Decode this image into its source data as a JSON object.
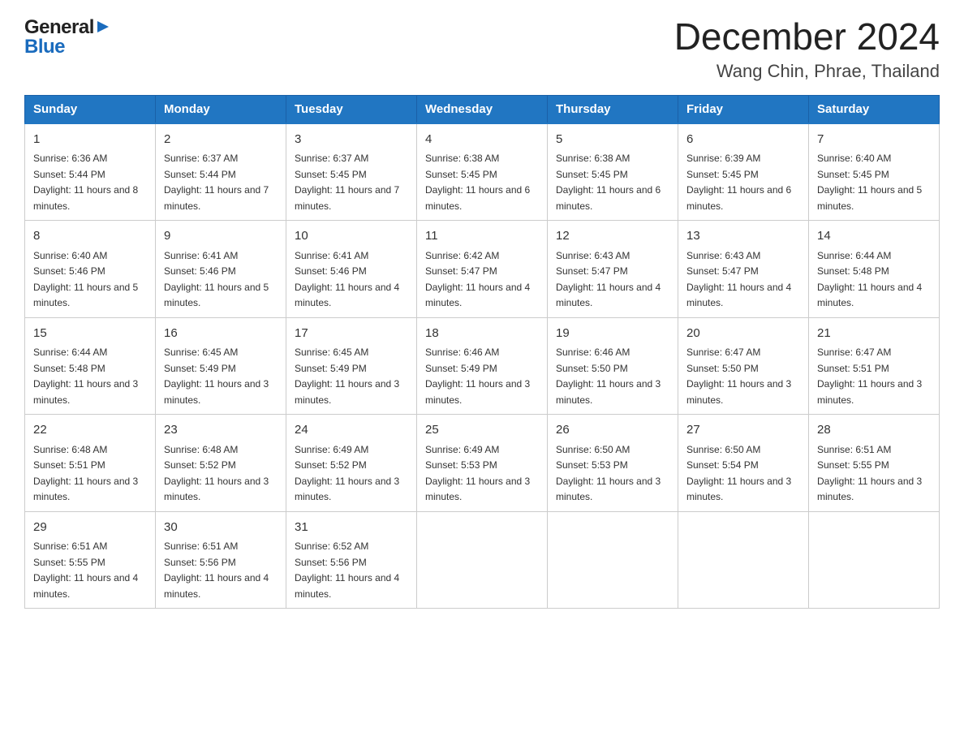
{
  "header": {
    "logo_general": "General",
    "logo_blue": "Blue",
    "month_title": "December 2024",
    "location": "Wang Chin, Phrae, Thailand"
  },
  "days_of_week": [
    "Sunday",
    "Monday",
    "Tuesday",
    "Wednesday",
    "Thursday",
    "Friday",
    "Saturday"
  ],
  "weeks": [
    [
      {
        "day": "1",
        "sunrise": "Sunrise: 6:36 AM",
        "sunset": "Sunset: 5:44 PM",
        "daylight": "Daylight: 11 hours and 8 minutes."
      },
      {
        "day": "2",
        "sunrise": "Sunrise: 6:37 AM",
        "sunset": "Sunset: 5:44 PM",
        "daylight": "Daylight: 11 hours and 7 minutes."
      },
      {
        "day": "3",
        "sunrise": "Sunrise: 6:37 AM",
        "sunset": "Sunset: 5:45 PM",
        "daylight": "Daylight: 11 hours and 7 minutes."
      },
      {
        "day": "4",
        "sunrise": "Sunrise: 6:38 AM",
        "sunset": "Sunset: 5:45 PM",
        "daylight": "Daylight: 11 hours and 6 minutes."
      },
      {
        "day": "5",
        "sunrise": "Sunrise: 6:38 AM",
        "sunset": "Sunset: 5:45 PM",
        "daylight": "Daylight: 11 hours and 6 minutes."
      },
      {
        "day": "6",
        "sunrise": "Sunrise: 6:39 AM",
        "sunset": "Sunset: 5:45 PM",
        "daylight": "Daylight: 11 hours and 6 minutes."
      },
      {
        "day": "7",
        "sunrise": "Sunrise: 6:40 AM",
        "sunset": "Sunset: 5:45 PM",
        "daylight": "Daylight: 11 hours and 5 minutes."
      }
    ],
    [
      {
        "day": "8",
        "sunrise": "Sunrise: 6:40 AM",
        "sunset": "Sunset: 5:46 PM",
        "daylight": "Daylight: 11 hours and 5 minutes."
      },
      {
        "day": "9",
        "sunrise": "Sunrise: 6:41 AM",
        "sunset": "Sunset: 5:46 PM",
        "daylight": "Daylight: 11 hours and 5 minutes."
      },
      {
        "day": "10",
        "sunrise": "Sunrise: 6:41 AM",
        "sunset": "Sunset: 5:46 PM",
        "daylight": "Daylight: 11 hours and 4 minutes."
      },
      {
        "day": "11",
        "sunrise": "Sunrise: 6:42 AM",
        "sunset": "Sunset: 5:47 PM",
        "daylight": "Daylight: 11 hours and 4 minutes."
      },
      {
        "day": "12",
        "sunrise": "Sunrise: 6:43 AM",
        "sunset": "Sunset: 5:47 PM",
        "daylight": "Daylight: 11 hours and 4 minutes."
      },
      {
        "day": "13",
        "sunrise": "Sunrise: 6:43 AM",
        "sunset": "Sunset: 5:47 PM",
        "daylight": "Daylight: 11 hours and 4 minutes."
      },
      {
        "day": "14",
        "sunrise": "Sunrise: 6:44 AM",
        "sunset": "Sunset: 5:48 PM",
        "daylight": "Daylight: 11 hours and 4 minutes."
      }
    ],
    [
      {
        "day": "15",
        "sunrise": "Sunrise: 6:44 AM",
        "sunset": "Sunset: 5:48 PM",
        "daylight": "Daylight: 11 hours and 3 minutes."
      },
      {
        "day": "16",
        "sunrise": "Sunrise: 6:45 AM",
        "sunset": "Sunset: 5:49 PM",
        "daylight": "Daylight: 11 hours and 3 minutes."
      },
      {
        "day": "17",
        "sunrise": "Sunrise: 6:45 AM",
        "sunset": "Sunset: 5:49 PM",
        "daylight": "Daylight: 11 hours and 3 minutes."
      },
      {
        "day": "18",
        "sunrise": "Sunrise: 6:46 AM",
        "sunset": "Sunset: 5:49 PM",
        "daylight": "Daylight: 11 hours and 3 minutes."
      },
      {
        "day": "19",
        "sunrise": "Sunrise: 6:46 AM",
        "sunset": "Sunset: 5:50 PM",
        "daylight": "Daylight: 11 hours and 3 minutes."
      },
      {
        "day": "20",
        "sunrise": "Sunrise: 6:47 AM",
        "sunset": "Sunset: 5:50 PM",
        "daylight": "Daylight: 11 hours and 3 minutes."
      },
      {
        "day": "21",
        "sunrise": "Sunrise: 6:47 AM",
        "sunset": "Sunset: 5:51 PM",
        "daylight": "Daylight: 11 hours and 3 minutes."
      }
    ],
    [
      {
        "day": "22",
        "sunrise": "Sunrise: 6:48 AM",
        "sunset": "Sunset: 5:51 PM",
        "daylight": "Daylight: 11 hours and 3 minutes."
      },
      {
        "day": "23",
        "sunrise": "Sunrise: 6:48 AM",
        "sunset": "Sunset: 5:52 PM",
        "daylight": "Daylight: 11 hours and 3 minutes."
      },
      {
        "day": "24",
        "sunrise": "Sunrise: 6:49 AM",
        "sunset": "Sunset: 5:52 PM",
        "daylight": "Daylight: 11 hours and 3 minutes."
      },
      {
        "day": "25",
        "sunrise": "Sunrise: 6:49 AM",
        "sunset": "Sunset: 5:53 PM",
        "daylight": "Daylight: 11 hours and 3 minutes."
      },
      {
        "day": "26",
        "sunrise": "Sunrise: 6:50 AM",
        "sunset": "Sunset: 5:53 PM",
        "daylight": "Daylight: 11 hours and 3 minutes."
      },
      {
        "day": "27",
        "sunrise": "Sunrise: 6:50 AM",
        "sunset": "Sunset: 5:54 PM",
        "daylight": "Daylight: 11 hours and 3 minutes."
      },
      {
        "day": "28",
        "sunrise": "Sunrise: 6:51 AM",
        "sunset": "Sunset: 5:55 PM",
        "daylight": "Daylight: 11 hours and 3 minutes."
      }
    ],
    [
      {
        "day": "29",
        "sunrise": "Sunrise: 6:51 AM",
        "sunset": "Sunset: 5:55 PM",
        "daylight": "Daylight: 11 hours and 4 minutes."
      },
      {
        "day": "30",
        "sunrise": "Sunrise: 6:51 AM",
        "sunset": "Sunset: 5:56 PM",
        "daylight": "Daylight: 11 hours and 4 minutes."
      },
      {
        "day": "31",
        "sunrise": "Sunrise: 6:52 AM",
        "sunset": "Sunset: 5:56 PM",
        "daylight": "Daylight: 11 hours and 4 minutes."
      },
      {
        "day": "",
        "sunrise": "",
        "sunset": "",
        "daylight": ""
      },
      {
        "day": "",
        "sunrise": "",
        "sunset": "",
        "daylight": ""
      },
      {
        "day": "",
        "sunrise": "",
        "sunset": "",
        "daylight": ""
      },
      {
        "day": "",
        "sunrise": "",
        "sunset": "",
        "daylight": ""
      }
    ]
  ]
}
